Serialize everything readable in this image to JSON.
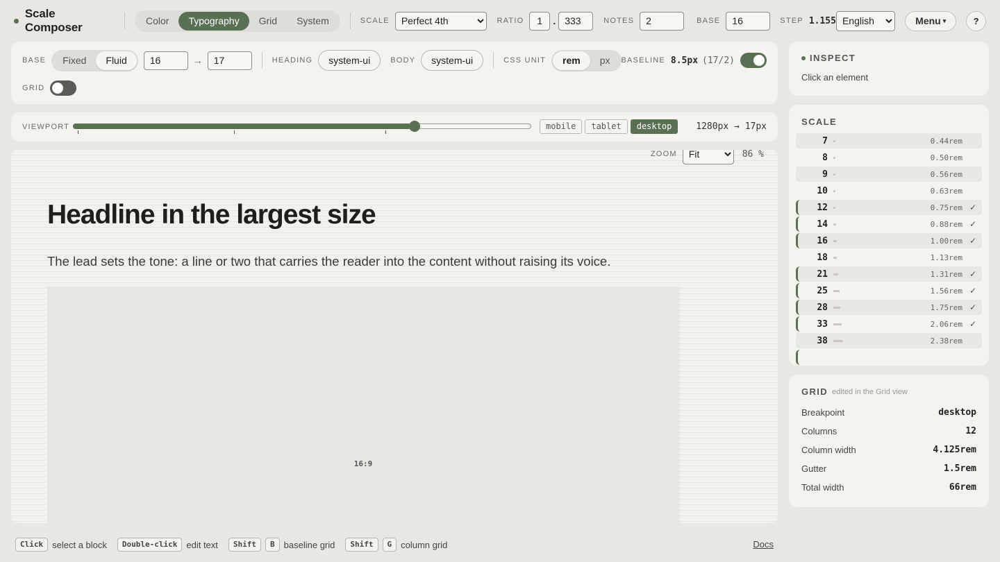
{
  "app": {
    "title": "Scale Composer"
  },
  "nav_tabs": [
    {
      "label": "Color",
      "active": false
    },
    {
      "label": "Typography",
      "active": true
    },
    {
      "label": "Grid",
      "active": false
    },
    {
      "label": "System",
      "active": false
    }
  ],
  "topbar": {
    "scale_label": "SCALE",
    "scale_value": "Perfect 4th",
    "ratio_label": "RATIO",
    "ratio_int": "1",
    "ratio_dot": ".",
    "ratio_frac": "333",
    "notes_label": "NOTES",
    "notes_value": "2",
    "base_label": "BASE",
    "base_value": "16",
    "step_label": "STEP",
    "step_value": "1.155",
    "language": "English",
    "menu_label": "Menu",
    "menu_caret": "▾",
    "help_label": "?"
  },
  "toolbar": {
    "base_label": "BASE",
    "base_modes": [
      {
        "label": "Fixed",
        "active": false
      },
      {
        "label": "Fluid",
        "active": true
      }
    ],
    "base_min": "16",
    "arrow": "→",
    "base_max": "17",
    "heading_label": "HEADING",
    "heading_font": "system-ui",
    "body_label": "BODY",
    "body_font": "system-ui",
    "unit_label": "CSS UNIT",
    "units": [
      {
        "label": "rem",
        "active": true
      },
      {
        "label": "px",
        "active": false
      }
    ],
    "baseline_label": "BASELINE",
    "baseline_value": "8.5px",
    "baseline_ratio": "(17/2)",
    "baseline_on": true,
    "grid_label": "GRID",
    "grid_on": false
  },
  "viewport": {
    "label": "VIEWPORT",
    "position": 0.745,
    "devices": [
      {
        "label": "mobile",
        "active": false
      },
      {
        "label": "tablet",
        "active": false
      },
      {
        "label": "desktop",
        "active": true
      }
    ],
    "readout": "1280px → 17px"
  },
  "preview": {
    "zoom_label": "ZOOM",
    "zoom_value": "Fit",
    "zoom_pct": "86 %",
    "headline": "Headline in the largest size",
    "lead": "The lead sets the tone: a line or two that carries the reader into the content without raising its voice.",
    "media_label": "16:9"
  },
  "inspect": {
    "title": "INSPECT",
    "hint": "Click an element"
  },
  "scale": {
    "title": "SCALE",
    "steps": [
      {
        "px": "7",
        "rem": "0.44rem",
        "used": false
      },
      {
        "px": "8",
        "rem": "0.50rem",
        "used": false
      },
      {
        "px": "9",
        "rem": "0.56rem",
        "used": false
      },
      {
        "px": "10",
        "rem": "0.63rem",
        "used": false
      },
      {
        "px": "12",
        "rem": "0.75rem",
        "used": true
      },
      {
        "px": "14",
        "rem": "0.88rem",
        "used": true
      },
      {
        "px": "16",
        "rem": "1.00rem",
        "used": true
      },
      {
        "px": "18",
        "rem": "1.13rem",
        "used": false
      },
      {
        "px": "21",
        "rem": "1.31rem",
        "used": true
      },
      {
        "px": "25",
        "rem": "1.56rem",
        "used": true
      },
      {
        "px": "28",
        "rem": "1.75rem",
        "used": true
      },
      {
        "px": "33",
        "rem": "2.06rem",
        "used": true
      },
      {
        "px": "38",
        "rem": "2.38rem",
        "used": false
      }
    ],
    "check": "✓"
  },
  "grid": {
    "title": "GRID",
    "note": "edited in the Grid view",
    "rows": [
      {
        "key": "Breakpoint",
        "value": "desktop"
      },
      {
        "key": "Columns",
        "value": "12"
      },
      {
        "key": "Column width",
        "value": "4.125rem"
      },
      {
        "key": "Gutter",
        "value": "1.5rem"
      },
      {
        "key": "Total width",
        "value": "66rem"
      }
    ]
  },
  "footer": {
    "click_key": "Click",
    "click_text": "select a block",
    "dbl_key": "Double-click",
    "dbl_text": "edit text",
    "shift_key": "Shift",
    "b_key": "B",
    "b_text": "baseline grid",
    "g_key": "G",
    "g_text": "column grid",
    "docs": "Docs"
  },
  "colors": {
    "accent": "#5a7052",
    "background": "#e8e7e2",
    "panel": "#f4f3ef"
  }
}
